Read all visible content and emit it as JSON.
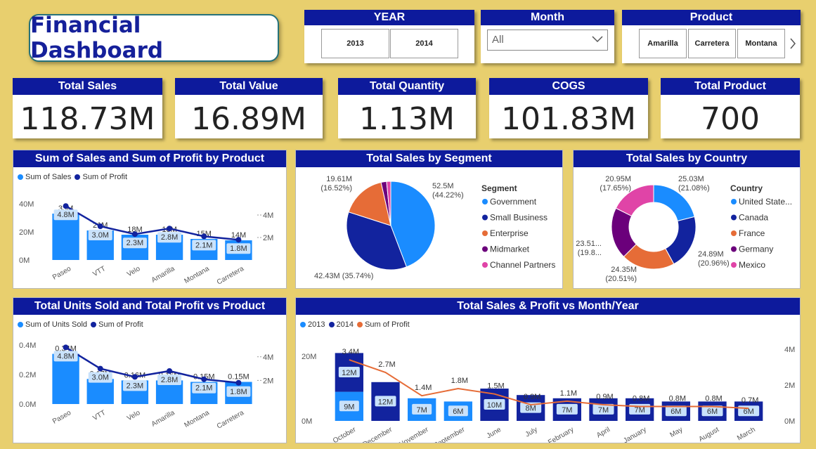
{
  "title": "Financial Dashboard",
  "colors": {
    "navy": "#0d1a9c",
    "blue": "#1a8cff",
    "darkblue": "#12239e",
    "orange": "#e66c37",
    "purple": "#6b007b",
    "pink": "#e044a7",
    "bg": "#e8cf6e"
  },
  "slicers": {
    "year": {
      "label": "YEAR",
      "options": [
        "2013",
        "2014"
      ]
    },
    "month": {
      "label": "Month",
      "value": "All",
      "icon": "chevron-down-icon"
    },
    "product": {
      "label": "Product",
      "options": [
        "Amarilla",
        "Carretera",
        "Montana"
      ],
      "next_icon": "chevron-right-icon"
    }
  },
  "kpis": [
    {
      "label": "Total Sales",
      "value": "118.73M"
    },
    {
      "label": "Total Value",
      "value": "16.89M"
    },
    {
      "label": "Total Quantity",
      "value": "1.13M"
    },
    {
      "label": "COGS",
      "value": "101.83M"
    },
    {
      "label": "Total Product",
      "value": "700"
    }
  ],
  "panels": {
    "sales_profit_product": {
      "title": "Sum of Sales and Sum of Profit by Product",
      "legend": [
        "Sum of  Sales",
        "Sum of Profit"
      ],
      "y_left": [
        "40M",
        "20M",
        "0M"
      ],
      "y_right": [
        "4M",
        "2M"
      ]
    },
    "segment": {
      "title": "Total Sales by Segment",
      "legend_title": "Segment"
    },
    "country": {
      "title": "Total Sales by Country",
      "legend_title": "Country"
    },
    "units_profit_product": {
      "title": "Total Units Sold and Total Profit vs Product",
      "legend": [
        "Sum of Units Sold",
        "Sum of Profit"
      ],
      "y_left": [
        "0.4M",
        "0.2M",
        "0.0M"
      ],
      "y_right": [
        "4M",
        "2M"
      ]
    },
    "month_year": {
      "title": "Total Sales & Profit vs Month/Year",
      "legend": [
        "2013",
        "2014",
        "Sum of Profit"
      ],
      "y_left": [
        "20M",
        "0M"
      ],
      "y_right": [
        "4M",
        "2M",
        "0M"
      ]
    }
  },
  "chart_data": [
    {
      "type": "bar",
      "title": "Sum of Sales and Sum of Profit by Product",
      "categories": [
        "Paseo",
        "VTT",
        "Velo",
        "Amarilla",
        "Montana",
        "Carretera"
      ],
      "series": [
        {
          "name": "Sum of  Sales",
          "values": [
            33,
            21,
            18,
            18,
            15,
            14
          ],
          "labels": [
            "33M",
            "21M",
            "18M",
            "18M",
            "15M",
            "14M"
          ]
        },
        {
          "name": "Sum of Profit",
          "values": [
            4.8,
            3.0,
            2.3,
            2.8,
            2.1,
            1.8
          ],
          "labels": [
            "4.8M",
            "3.0M",
            "2.3M",
            "2.8M",
            "2.1M",
            "1.8M"
          ]
        }
      ],
      "ylim": [
        0,
        40
      ],
      "y2lim": [
        0,
        5
      ]
    },
    {
      "type": "pie",
      "title": "Total Sales by Segment",
      "slices": [
        {
          "name": "Government",
          "value": 52.5,
          "label": "52.5M",
          "pct": "(44.22%)"
        },
        {
          "name": "Small Business",
          "value": 42.43,
          "label": "42.43M (35.74%)",
          "pct": ""
        },
        {
          "name": "Enterprise",
          "value": 19.61,
          "label": "19.61M",
          "pct": "(16.52%)"
        },
        {
          "name": "Midmarket",
          "value": 2.4,
          "label": "",
          "pct": ""
        },
        {
          "name": "Channel Partners",
          "value": 1.8,
          "label": "",
          "pct": ""
        }
      ]
    },
    {
      "type": "pie",
      "title": "Total Sales by Country",
      "donut": true,
      "slices": [
        {
          "name": "United State...",
          "value": 25.03,
          "label": "25.03M",
          "pct": "(21.08%)"
        },
        {
          "name": "Canada",
          "value": 24.89,
          "label": "24.89M",
          "pct": "(20.96%)"
        },
        {
          "name": "France",
          "value": 24.35,
          "label": "24.35M",
          "pct": "(20.51%)"
        },
        {
          "name": "Germany",
          "value": 23.51,
          "label": "23.51...",
          "pct": "(19.8..."
        },
        {
          "name": "Mexico",
          "value": 20.95,
          "label": "20.95M",
          "pct": "(17.65%)"
        }
      ]
    },
    {
      "type": "bar",
      "title": "Total Units Sold and Total Profit vs Product",
      "categories": [
        "Paseo",
        "VTT",
        "Velo",
        "Amarilla",
        "Montana",
        "Carretera"
      ],
      "series": [
        {
          "name": "Sum of Units Sold",
          "values": [
            0.34,
            0.17,
            0.16,
            0.16,
            0.15,
            0.15
          ],
          "labels": [
            "0.34M",
            "0.17M",
            "0.16M",
            "0.16M",
            "0.15M",
            "0.15M"
          ]
        },
        {
          "name": "Sum of Profit",
          "values": [
            4.8,
            3.0,
            2.3,
            2.8,
            2.1,
            1.8
          ],
          "labels": [
            "4.8M",
            "3.0M",
            "2.3M",
            "2.8M",
            "2.1M",
            "1.8M"
          ]
        }
      ],
      "ylim": [
        0,
        0.4
      ],
      "y2lim": [
        0,
        5
      ]
    },
    {
      "type": "bar",
      "title": "Total Sales & Profit vs Month/Year",
      "categories": [
        "October",
        "December",
        "November",
        "September",
        "June",
        "July",
        "February",
        "April",
        "January",
        "May",
        "August",
        "March"
      ],
      "series": [
        {
          "name": "2013",
          "values": [
            9,
            0,
            7,
            6,
            0,
            0,
            0,
            0,
            0,
            0,
            0,
            0
          ],
          "labels": [
            "9M",
            "",
            "7M",
            "6M",
            "",
            "",
            "",
            "",
            "",
            "",
            "",
            ""
          ]
        },
        {
          "name": "2014",
          "values": [
            12,
            12,
            0,
            0,
            10,
            8,
            7,
            7,
            7,
            6,
            6,
            6
          ],
          "labels": [
            "12M",
            "12M",
            "",
            "",
            "10M",
            "8M",
            "7M",
            "7M",
            "7M",
            "6M",
            "6M",
            "6M"
          ]
        },
        {
          "name": "Sum of Profit",
          "values": [
            3.4,
            2.7,
            1.4,
            1.8,
            1.5,
            0.9,
            1.1,
            0.9,
            0.8,
            0.8,
            0.8,
            0.7
          ],
          "labels": [
            "3.4M",
            "2.7M",
            "1.4M",
            "1.8M",
            "1.5M",
            "0.9M",
            "1.1M",
            "0.9M",
            "0.8M",
            "0.8M",
            "0.8M",
            "0.7M"
          ]
        }
      ],
      "ylim": [
        0,
        25
      ],
      "y2lim": [
        0,
        4.5
      ]
    }
  ]
}
